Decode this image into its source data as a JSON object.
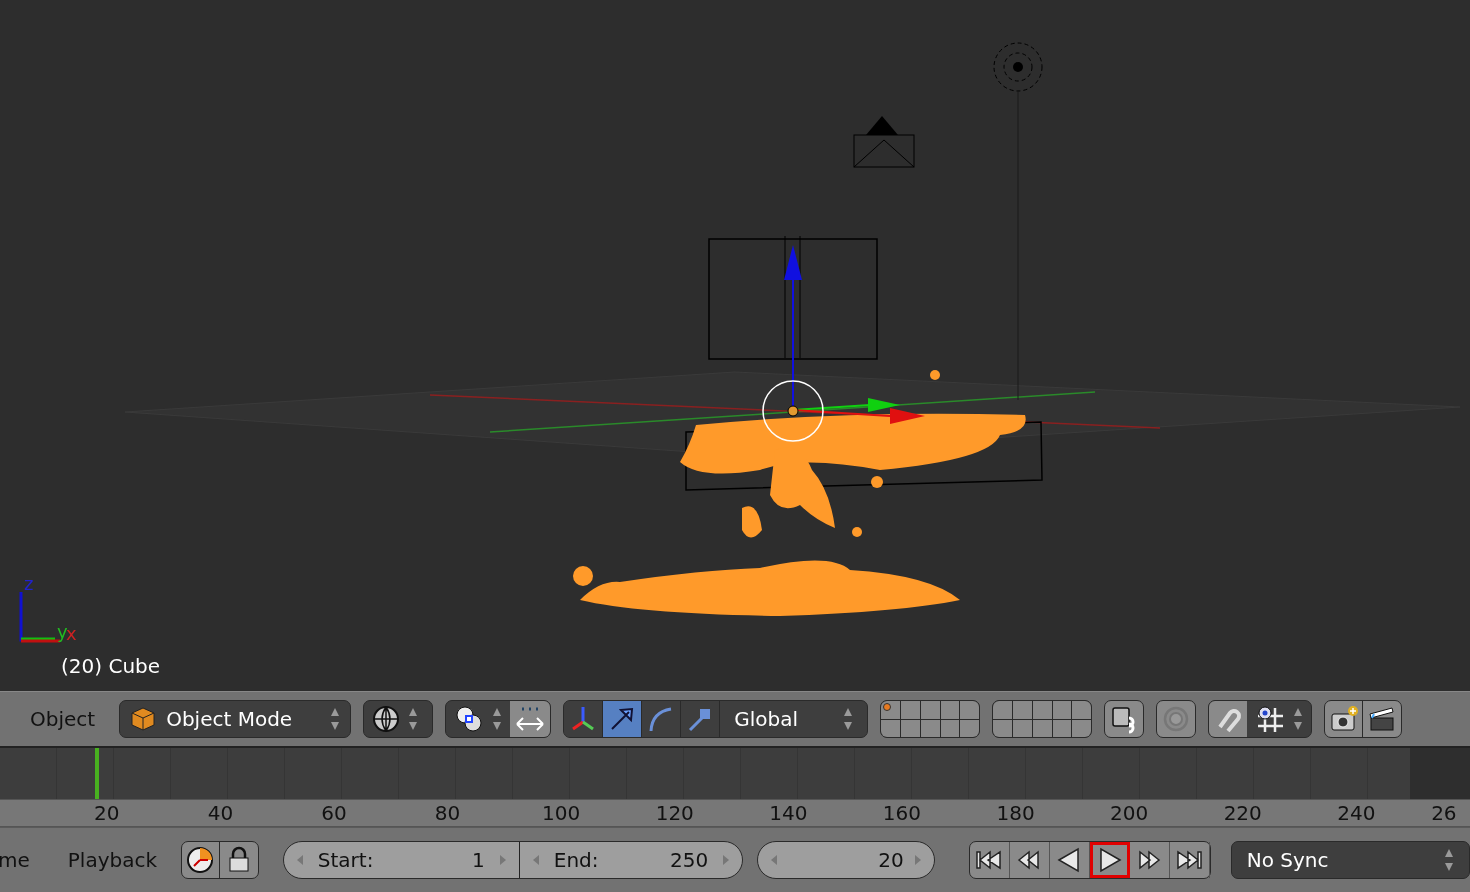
{
  "viewport": {
    "axis_labels": {
      "z": "z",
      "y": "y",
      "x": "x"
    },
    "object_info": "(20) Cube"
  },
  "header": {
    "menu": "Object",
    "mode": "Object Mode",
    "orientation": "Global",
    "manipulators": [
      {
        "kind": "toggle",
        "selected": false
      },
      {
        "kind": "translate",
        "selected": true
      },
      {
        "kind": "rotate",
        "selected": false
      },
      {
        "kind": "scale",
        "selected": false
      }
    ],
    "layers": [
      {
        "has_object": true
      },
      {
        "has_object": false
      },
      {
        "has_object": false
      },
      {
        "has_object": false
      },
      {
        "has_object": false
      },
      {
        "has_object": false
      },
      {
        "has_object": false
      },
      {
        "has_object": false
      },
      {
        "has_object": false
      },
      {
        "has_object": false
      },
      {
        "has_object": false
      },
      {
        "has_object": false
      },
      {
        "has_object": false
      },
      {
        "has_object": false
      },
      {
        "has_object": false
      },
      {
        "has_object": false
      },
      {
        "has_object": false
      },
      {
        "has_object": false
      },
      {
        "has_object": false
      },
      {
        "has_object": false
      }
    ]
  },
  "timeline": {
    "ruler": [
      "20",
      "40",
      "60",
      "80",
      "100",
      "120",
      "140",
      "160",
      "180",
      "200",
      "220",
      "240",
      "26"
    ]
  },
  "footer": {
    "menus": [
      "me",
      "Playback"
    ],
    "start_label": "Start:",
    "start": "1",
    "end_label": "End:",
    "end": "250",
    "current": "20",
    "transport": [
      {
        "kind": "jump-start",
        "highlighted": false
      },
      {
        "kind": "jump-back",
        "highlighted": false
      },
      {
        "kind": "play-reverse",
        "highlighted": false
      },
      {
        "kind": "play",
        "highlighted": true
      },
      {
        "kind": "jump-forward",
        "highlighted": false
      },
      {
        "kind": "jump-end",
        "highlighted": false
      }
    ],
    "sync": "No Sync"
  }
}
